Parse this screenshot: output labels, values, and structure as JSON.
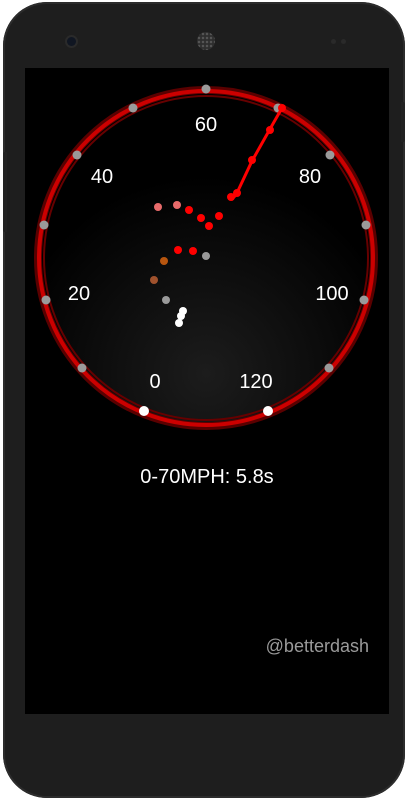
{
  "gauge": {
    "labels": [
      "0",
      "20",
      "40",
      "60",
      "80",
      "100",
      "120"
    ],
    "ring_color": "#cc0000",
    "trace_color": "#ff0000"
  },
  "result": {
    "text": "0-70MPH: 5.8s"
  },
  "watermark": {
    "text": "@betterdash"
  }
}
